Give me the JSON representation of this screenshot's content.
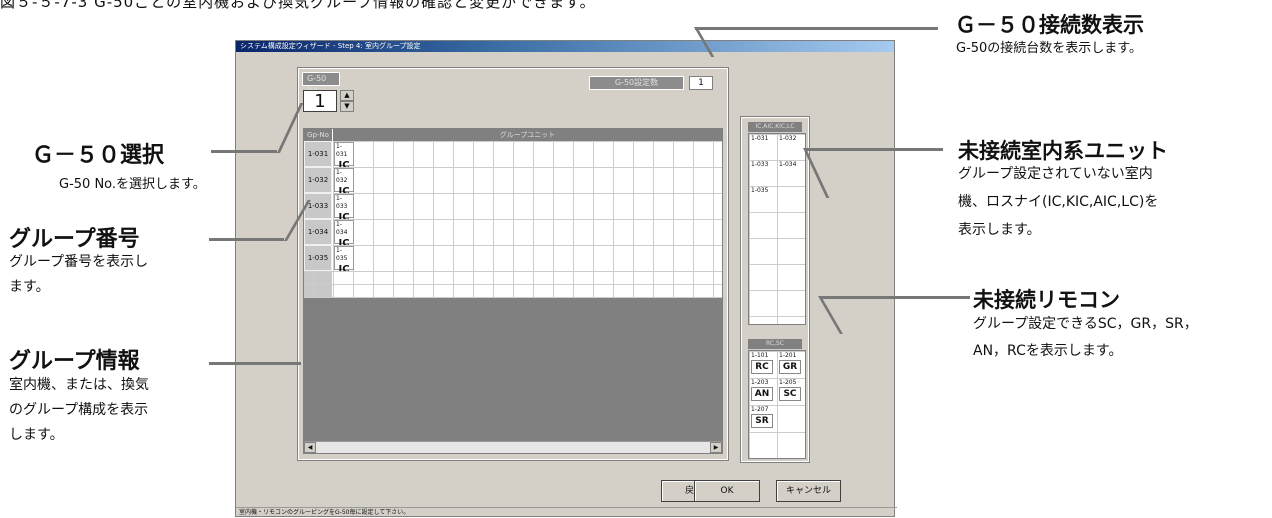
{
  "top_caption": "図５-５-7-3 G-50ごとの室内機および換気グループ情報の確認と変更ができます。",
  "window": {
    "title": "システム構成設定ウィザード - Step 4: 室内グループ設定",
    "g50_no_label": "G-50 No.",
    "g50_no_value": "1",
    "g50_count_label": "G-50設定数",
    "g50_count_value": "1",
    "col_group_no": "Gp-No",
    "col_group_unit": "グループユニット",
    "groups": [
      {
        "no": "1-031",
        "addr": "1-031",
        "type": "IC"
      },
      {
        "no": "1-032",
        "addr": "1-032",
        "type": "IC"
      },
      {
        "no": "1-033",
        "addr": "1-033",
        "type": "IC"
      },
      {
        "no": "1-034",
        "addr": "1-034",
        "type": "IC"
      },
      {
        "no": "1-035",
        "addr": "1-035",
        "type": "IC"
      }
    ],
    "ic_list_label": "IC,AIC,KIC,LC",
    "ic_items": [
      "1-031",
      "1-032",
      "1-033",
      "1-034",
      "1-035"
    ],
    "rc_list_label": "RC,SC",
    "rc_items": [
      {
        "addr": "1-101",
        "type": "RC"
      },
      {
        "addr": "1-201",
        "type": "GR"
      },
      {
        "addr": "1-203",
        "type": "AN"
      },
      {
        "addr": "1-205",
        "type": "SC"
      },
      {
        "addr": "1-207",
        "type": "SR"
      }
    ],
    "btn_back": "戻る",
    "btn_ok": "OK",
    "btn_cancel": "キャンセル",
    "status": "室内機・リモコンのグルーピングをG-50毎に設定して下さい。"
  },
  "callouts": {
    "g50_select": {
      "title": "Ｇ－５０選択",
      "desc": "G-50 No.を選択します。"
    },
    "group_no": {
      "title": "グループ番号",
      "desc1": "グループ番号を表示し",
      "desc2": "ます。"
    },
    "group_info": {
      "title": "グループ情報",
      "desc1": "室内機、または、換気",
      "desc2": "のグループ構成を表示",
      "desc3": "します。"
    },
    "g50_count": {
      "title": "Ｇ－５０接続数表示",
      "desc": "G-50の接続台数を表示します。"
    },
    "unconnected_ic": {
      "title": "未接続室内系ユニット",
      "desc1": "グループ設定されていない室内",
      "desc2": "機、ロスナイ(IC,KIC,AIC,LC)を",
      "desc3": "表示します。"
    },
    "unconnected_rc": {
      "title": "未接続リモコン",
      "desc1": "グループ設定できるSC，GR，SR，",
      "desc2": "AN，RCを表示します。"
    }
  }
}
